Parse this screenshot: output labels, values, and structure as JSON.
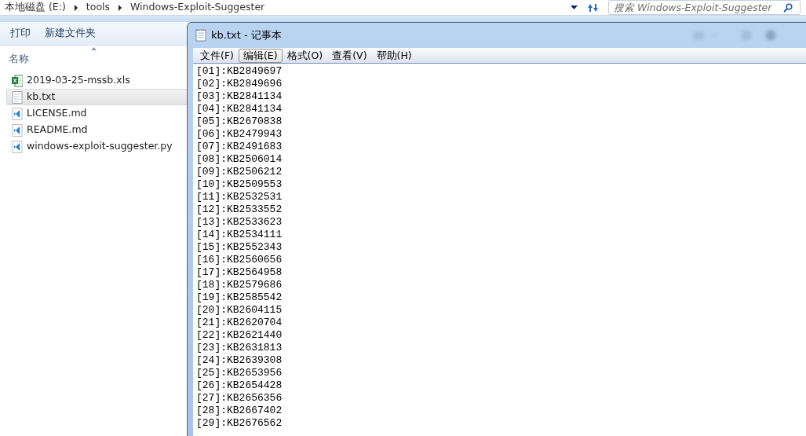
{
  "explorer": {
    "breadcrumb": [
      {
        "label": "本地磁盘 (E:)"
      },
      {
        "label": "tools"
      },
      {
        "label": "Windows-Exploit-Suggester"
      }
    ],
    "search": {
      "placeholder": "搜索 Windows-Exploit-Suggester"
    },
    "toolbar": [
      "打印",
      "新建文件夹"
    ],
    "column": "名称",
    "files": [
      {
        "name": "2019-03-25-mssb.xls",
        "kind": "sheet",
        "selected": false
      },
      {
        "name": "kb.txt",
        "kind": "text",
        "selected": true
      },
      {
        "name": "LICENSE.md",
        "kind": "code",
        "selected": false
      },
      {
        "name": "README.md",
        "kind": "code",
        "selected": false
      },
      {
        "name": "windows-exploit-suggester.py",
        "kind": "code",
        "selected": false
      }
    ]
  },
  "notepad": {
    "title": "kb.txt - 记事本",
    "menu": [
      {
        "label": "文件(F)",
        "selected": false
      },
      {
        "label": "编辑(E)",
        "selected": true
      },
      {
        "label": "格式(O)",
        "selected": false
      },
      {
        "label": "查看(V)",
        "selected": false
      },
      {
        "label": "帮助(H)",
        "selected": false
      }
    ],
    "lines": [
      "[01]:KB2849697",
      "[02]:KB2849696",
      "[03]:KB2841134",
      "[04]:KB2841134",
      "[05]:KB2670838",
      "[06]:KB2479943",
      "[07]:KB2491683",
      "[08]:KB2506014",
      "[09]:KB2506212",
      "[10]:KB2509553",
      "[11]:KB2532531",
      "[12]:KB2533552",
      "[13]:KB2533623",
      "[14]:KB2534111",
      "[15]:KB2552343",
      "[16]:KB2560656",
      "[17]:KB2564958",
      "[18]:KB2579686",
      "[19]:KB2585542",
      "[20]:KB2604115",
      "[21]:KB2620704",
      "[22]:KB2621440",
      "[23]:KB2631813",
      "[24]:KB2639308",
      "[25]:KB2653956",
      "[26]:KB2654428",
      "[27]:KB2656356",
      "[28]:KB2667402",
      "[29]:KB2676562"
    ]
  }
}
